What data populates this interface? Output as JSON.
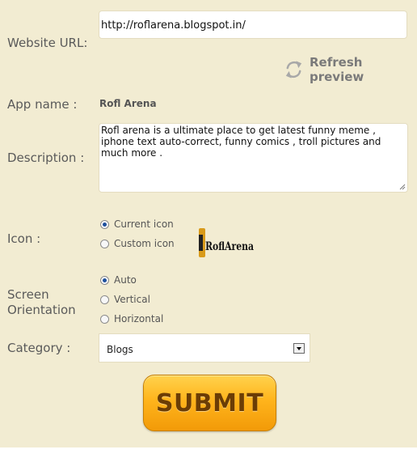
{
  "form": {
    "website_url_label": "Website URL:",
    "website_url_value": "http://roflarena.blogspot.in/",
    "refresh_label": "Refresh preview",
    "app_name_label": "App name :",
    "app_name_value": "Rofl Arena",
    "description_label": "Description :",
    "description_value": "Rofl arena is a ultimate place to get latest funny meme , iphone text auto-correct, funny comics , troll pictures and much more .",
    "icon_label": "Icon :",
    "icon_options": [
      {
        "label": "Current icon",
        "selected": true
      },
      {
        "label": "Custom icon",
        "selected": false
      }
    ],
    "icon_image_text": "RoflArena",
    "orientation_label_1": "Screen",
    "orientation_label_2": "Orientation",
    "orientation_options": [
      {
        "label": "Auto",
        "selected": true
      },
      {
        "label": "Vertical",
        "selected": false
      },
      {
        "label": "Horizontal",
        "selected": false
      }
    ],
    "category_label": "Category :",
    "category_value": "Blogs",
    "submit_label": "SUBMIT"
  },
  "colors": {
    "panel_bg": "#f2ecd2",
    "submit_gradient_top": "#ffd24d",
    "submit_gradient_bottom": "#f29a08",
    "submit_text": "#6b3d05"
  }
}
